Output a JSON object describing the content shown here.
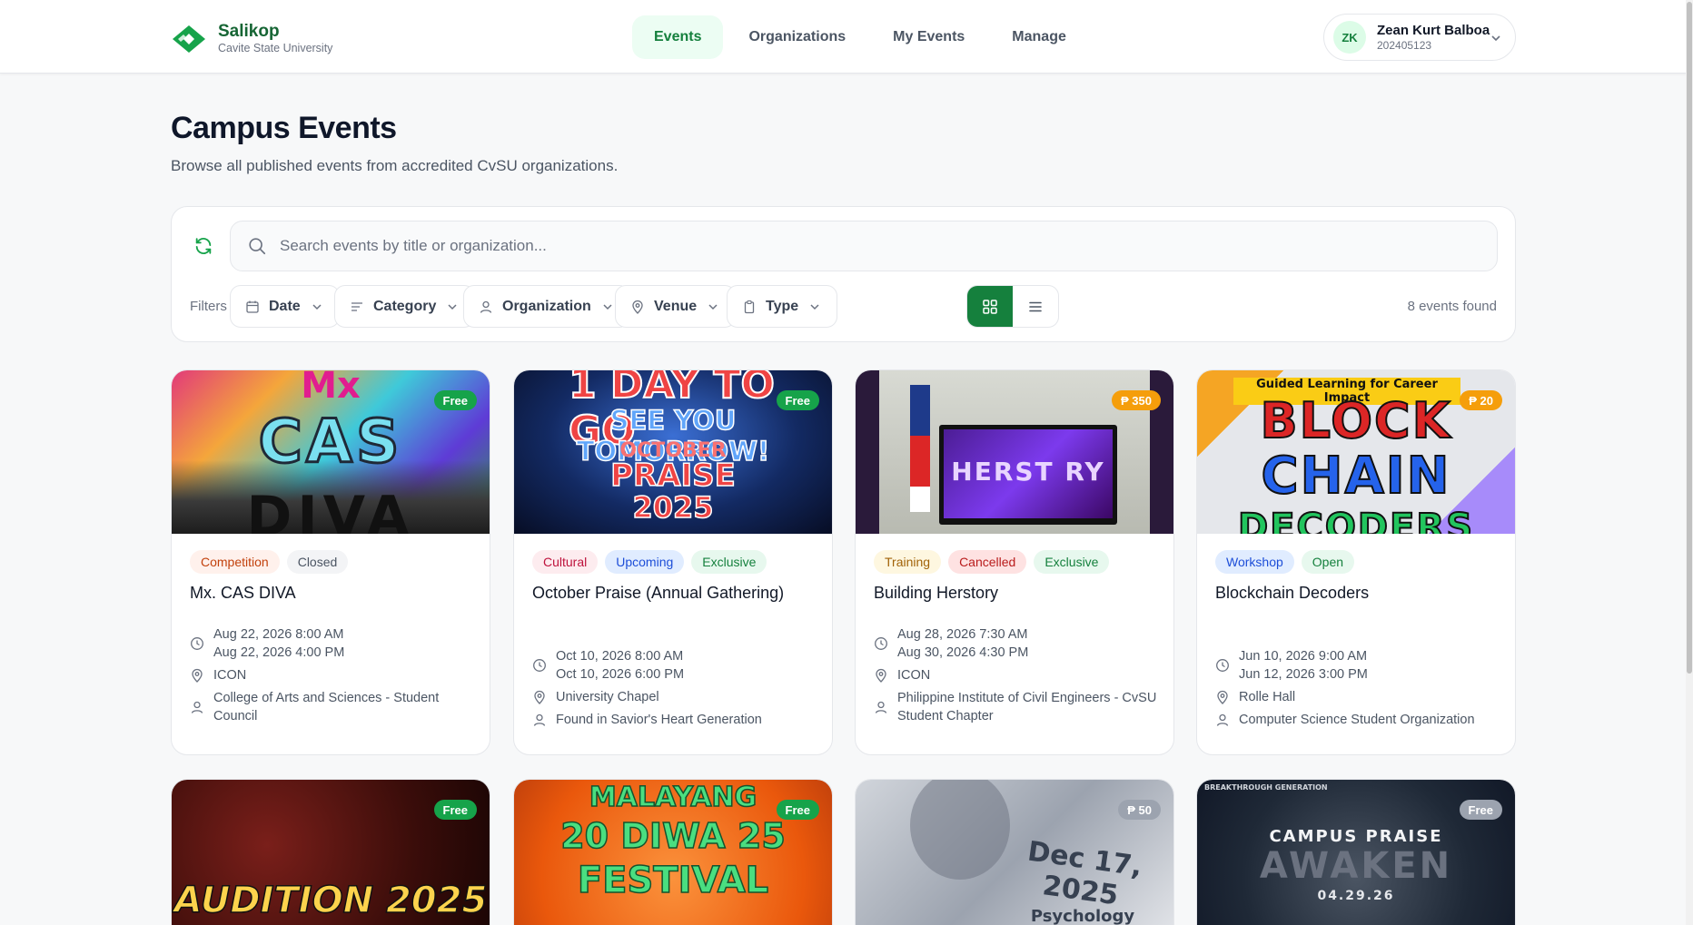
{
  "header": {
    "brand_name": "Salikop",
    "brand_sub": "Cavite State University",
    "nav": [
      "Events",
      "Organizations",
      "My Events",
      "Manage"
    ],
    "active_nav": "Events",
    "user": {
      "initials": "ZK",
      "name": "Zean Kurt Balboa",
      "id": "202405123"
    }
  },
  "page": {
    "title": "Campus Events",
    "subtitle": "Browse all published events from accredited CvSU organizations."
  },
  "filters": {
    "search_placeholder": "Search events by title or organization...",
    "label": "Filters",
    "buttons": [
      "Date",
      "Category",
      "Organization",
      "Venue",
      "Type"
    ],
    "view": "grid",
    "count_text": "8 events found"
  },
  "events": [
    {
      "price": "Free",
      "tags": [
        {
          "label": "Competition",
          "color": "orange"
        },
        {
          "label": "Closed",
          "color": "grey"
        }
      ],
      "title": "Mx. CAS DIVA",
      "date_start": "Aug 22, 2026 8:00 AM",
      "date_end": "Aug 22, 2026 4:00 PM",
      "venue": "ICON",
      "org": "College of Arts and Sciences - Student Council",
      "art_text": [
        "Mx",
        "CAS",
        "DIVA"
      ]
    },
    {
      "price": "Free",
      "tags": [
        {
          "label": "Cultural",
          "color": "pink"
        },
        {
          "label": "Upcoming",
          "color": "blue"
        },
        {
          "label": "Exclusive",
          "color": "green"
        }
      ],
      "title": "October Praise (Annual Gathering)",
      "date_start": "Oct 10, 2026 8:00 AM",
      "date_end": "Oct 10, 2026 6:00 PM",
      "venue": "University Chapel",
      "org": "Found in Savior's Heart Generation",
      "art_text": [
        "1 DAY TO GO",
        "SEE YOU TOMORROW!",
        "OCTOBER",
        "PRAISE",
        "2025"
      ]
    },
    {
      "price": "₱ 350",
      "tags": [
        {
          "label": "Training",
          "color": "yellow"
        },
        {
          "label": "Cancelled",
          "color": "red"
        },
        {
          "label": "Exclusive",
          "color": "green"
        }
      ],
      "title": "Building Herstory",
      "date_start": "Aug 28, 2026 7:30 AM",
      "date_end": "Aug 30, 2026 4:30 PM",
      "venue": "ICON",
      "org": "Philippine Institute of Civil Engineers - CvSU Student Chapter",
      "art_text": [
        "HERST RY"
      ]
    },
    {
      "price": "₱ 20",
      "tags": [
        {
          "label": "Workshop",
          "color": "blue"
        },
        {
          "label": "Open",
          "color": "green"
        }
      ],
      "title": "Blockchain Decoders",
      "date_start": "Jun 10, 2026 9:00 AM",
      "date_end": "Jun 12, 2026 3:00 PM",
      "venue": "Rolle Hall",
      "org": "Computer Science Student Organization",
      "art_text": [
        "Guided Learning for Career Impact",
        "BLOCK",
        "CHAIN",
        "DECODERS"
      ]
    },
    {
      "price": "Free",
      "art_text": [
        "AUDITION 2025"
      ]
    },
    {
      "price": "Free",
      "art_text": [
        "MALAYANG",
        "20 DIWA 25",
        "FESTIVAL"
      ]
    },
    {
      "price": "₱ 50",
      "art_text": [
        "Dec 17, 2025",
        "Psychology"
      ]
    },
    {
      "price": "Free",
      "art_text": [
        "BREAKTHROUGH GENERATION",
        "CAMPUS PRAISE",
        "AWAKEN",
        "04.29.26"
      ]
    }
  ],
  "colors": {
    "brand": "#166534",
    "accent": "#15803d",
    "free_badge": "#16a34a",
    "paid_badge": "#f59e0b"
  }
}
